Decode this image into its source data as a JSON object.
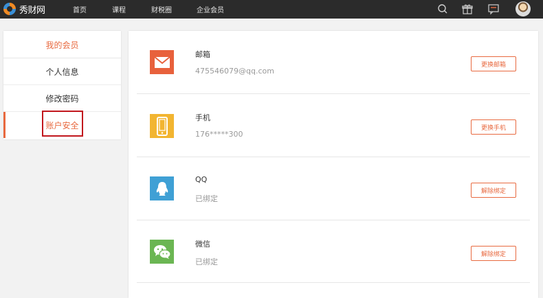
{
  "brand": {
    "name": "秀财网"
  },
  "nav": {
    "items": [
      "首页",
      "课程",
      "财税圈",
      "企业会员"
    ]
  },
  "top_icons": [
    "search-icon",
    "gift-icon",
    "message-icon"
  ],
  "sidebar": {
    "header": "我的会员",
    "items": [
      {
        "label": "个人信息"
      },
      {
        "label": "修改密码"
      },
      {
        "label": "账户安全"
      }
    ],
    "active_index": 2
  },
  "security": {
    "rows": [
      {
        "icon": "email-icon",
        "color": "#e8613c",
        "title": "邮箱",
        "value": "475546079@qq.com",
        "button": "更换邮箱"
      },
      {
        "icon": "phone-icon",
        "color": "#f2b531",
        "title": "手机",
        "value": "176*****300",
        "button": "更换手机"
      },
      {
        "icon": "qq-icon",
        "color": "#3fa0d5",
        "title": "QQ",
        "value": "已绑定",
        "button": "解除绑定"
      },
      {
        "icon": "wechat-icon",
        "color": "#6bb653",
        "title": "微信",
        "value": "已绑定",
        "button": "解除绑定"
      }
    ]
  },
  "colors": {
    "accent": "#e8693f",
    "topbar": "#2b2b2b",
    "highlight": "#c1161c"
  }
}
